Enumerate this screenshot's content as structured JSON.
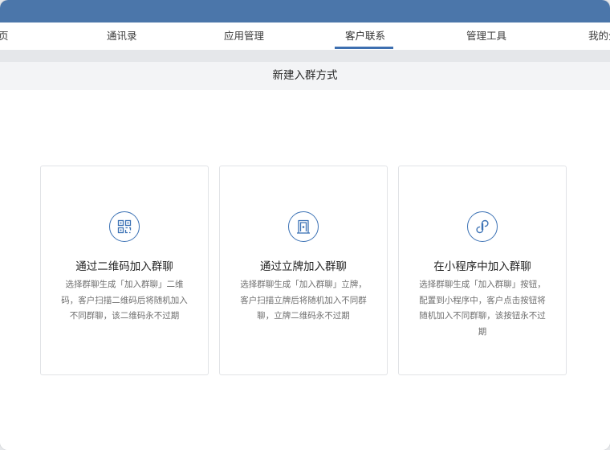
{
  "nav": {
    "items": [
      {
        "label": "页"
      },
      {
        "label": "通讯录"
      },
      {
        "label": "应用管理"
      },
      {
        "label": "客户联系"
      },
      {
        "label": "管理工具"
      },
      {
        "label": "我的企"
      }
    ],
    "active_index": 3,
    "accent_color": "#3d6fb0"
  },
  "header": {
    "color": "#4b76aa"
  },
  "page": {
    "title": "新建入群方式"
  },
  "cards": [
    {
      "icon": "qrcode-icon",
      "title": "通过二维码加入群聊",
      "desc": "选择群聊生成「加入群聊」二维码，客户扫描二维码后将随机加入不同群聊，该二维码永不过期"
    },
    {
      "icon": "sign-board-icon",
      "title": "通过立牌加入群聊",
      "desc": "选择群聊生成「加入群聊」立牌，客户扫描立牌后将随机加入不同群聊，立牌二维码永不过期"
    },
    {
      "icon": "mini-program-icon",
      "title": "在小程序中加入群聊",
      "desc": "选择群聊生成「加入群聊」按钮，配置到小程序中，客户点击按钮将随机加入不同群聊，该按钮永不过期"
    }
  ]
}
